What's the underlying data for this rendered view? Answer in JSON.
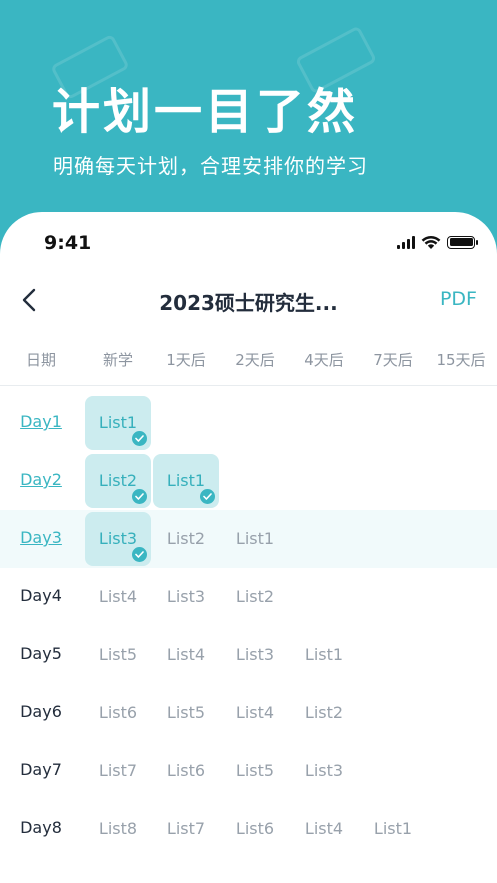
{
  "hero": {
    "title": "计划一目了然",
    "subtitle": "明确每天计划，合理安排你的学习"
  },
  "status": {
    "time": "9:41"
  },
  "nav": {
    "title": "2023硕士研究生...",
    "pdf_label": "PDF"
  },
  "columns": [
    "日期",
    "新学",
    "1天后",
    "2天后",
    "4天后",
    "7天后",
    "15天后"
  ],
  "rows": [
    {
      "day": "Day1",
      "linked": true,
      "highlight": false,
      "lists": [
        {
          "text": "List1",
          "done": true
        }
      ]
    },
    {
      "day": "Day2",
      "linked": true,
      "highlight": false,
      "lists": [
        {
          "text": "List2",
          "done": true
        },
        {
          "text": "List1",
          "done": true
        }
      ]
    },
    {
      "day": "Day3",
      "linked": true,
      "highlight": true,
      "lists": [
        {
          "text": "List3",
          "done": true
        },
        {
          "text": "List2",
          "done": false
        },
        {
          "text": "List1",
          "done": false
        }
      ]
    },
    {
      "day": "Day4",
      "linked": false,
      "highlight": false,
      "lists": [
        {
          "text": "List4",
          "done": false
        },
        {
          "text": "List3",
          "done": false
        },
        {
          "text": "List2",
          "done": false
        }
      ]
    },
    {
      "day": "Day5",
      "linked": false,
      "highlight": false,
      "lists": [
        {
          "text": "List5",
          "done": false
        },
        {
          "text": "List4",
          "done": false
        },
        {
          "text": "List3",
          "done": false
        },
        {
          "text": "List1",
          "done": false
        }
      ]
    },
    {
      "day": "Day6",
      "linked": false,
      "highlight": false,
      "lists": [
        {
          "text": "List6",
          "done": false
        },
        {
          "text": "List5",
          "done": false
        },
        {
          "text": "List4",
          "done": false
        },
        {
          "text": "List2",
          "done": false
        }
      ]
    },
    {
      "day": "Day7",
      "linked": false,
      "highlight": false,
      "lists": [
        {
          "text": "List7",
          "done": false
        },
        {
          "text": "List6",
          "done": false
        },
        {
          "text": "List5",
          "done": false
        },
        {
          "text": "List3",
          "done": false
        }
      ]
    },
    {
      "day": "Day8",
      "linked": false,
      "highlight": false,
      "lists": [
        {
          "text": "List8",
          "done": false
        },
        {
          "text": "List7",
          "done": false
        },
        {
          "text": "List6",
          "done": false
        },
        {
          "text": "List4",
          "done": false
        },
        {
          "text": "List1",
          "done": false
        }
      ]
    }
  ],
  "colors": {
    "accent": "#3ab6c2",
    "done_bg": "#ccecef",
    "text_dark": "#232d3c",
    "text_muted": "#98a1ab"
  }
}
